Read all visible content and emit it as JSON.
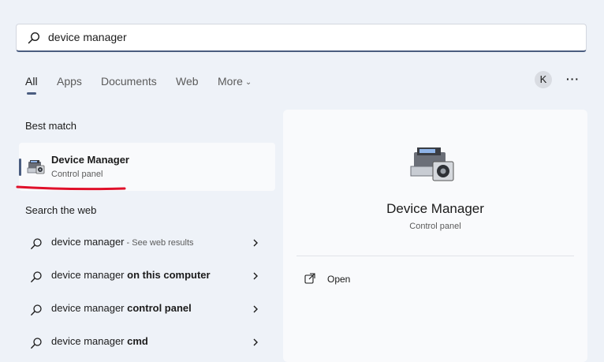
{
  "search": {
    "value": "device manager",
    "placeholder": ""
  },
  "filters": {
    "all": "All",
    "apps": "Apps",
    "documents": "Documents",
    "web": "Web",
    "more": "More"
  },
  "account": {
    "initial": "K"
  },
  "best_match": {
    "heading": "Best match",
    "title": "Device Manager",
    "subtitle": "Control panel"
  },
  "search_web": {
    "heading": "Search the web",
    "rows": [
      {
        "prefix": "device manager",
        "bold": "",
        "suffix": " - See web results"
      },
      {
        "prefix": "device manager ",
        "bold": "on this computer",
        "suffix": ""
      },
      {
        "prefix": "device manager ",
        "bold": "control panel",
        "suffix": ""
      },
      {
        "prefix": "device manager ",
        "bold": "cmd",
        "suffix": ""
      }
    ]
  },
  "detail": {
    "title": "Device Manager",
    "subtitle": "Control panel",
    "open_label": "Open"
  },
  "colors": {
    "accent": "#4a5d80",
    "annotation_red": "#e0102a",
    "background": "#eef2f8"
  },
  "icons": [
    "search-icon",
    "chevron-down-icon",
    "more-options-icon",
    "device-manager-icon",
    "chevron-right-icon",
    "open-external-icon"
  ]
}
